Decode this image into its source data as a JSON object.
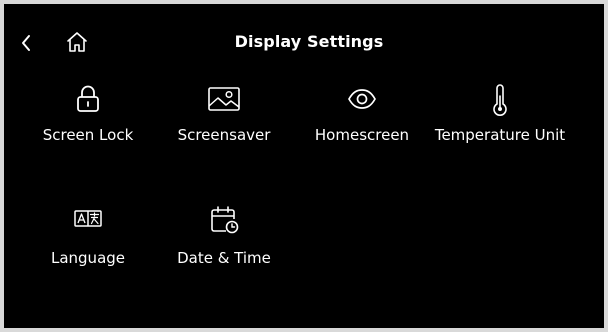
{
  "header": {
    "title": "Display Settings",
    "back_icon": "chevron-left-icon",
    "home_icon": "home-icon"
  },
  "settings": [
    {
      "label": "Screen Lock",
      "icon": "lock-icon"
    },
    {
      "label": "Screensaver",
      "icon": "image-icon"
    },
    {
      "label": "Homescreen",
      "icon": "eye-icon"
    },
    {
      "label": "Temperature Unit",
      "icon": "thermometer-icon"
    },
    {
      "label": "Language",
      "icon": "translate-icon"
    },
    {
      "label": "Date & Time",
      "icon": "calendar-clock-icon"
    }
  ],
  "colors": {
    "background": "#000000",
    "foreground": "#ffffff",
    "bezel": "#d9d9d9"
  }
}
